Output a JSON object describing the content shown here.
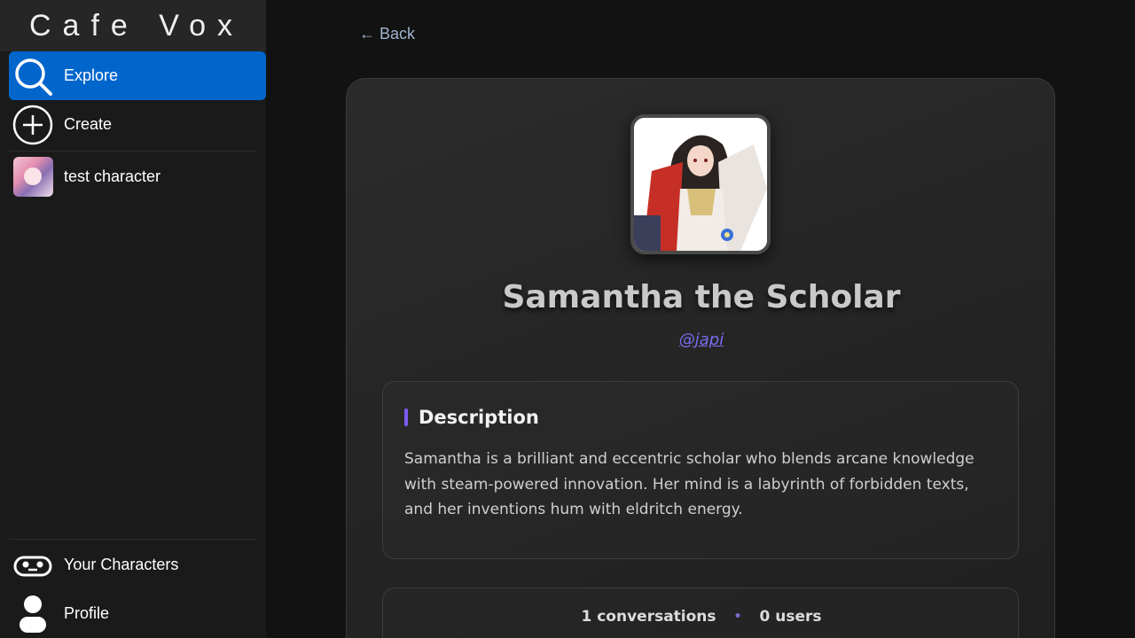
{
  "app": {
    "brand": "Cafe Vox"
  },
  "sidebar": {
    "explore_label": "Explore",
    "create_label": "Create",
    "recent_character_label": "test character",
    "your_characters_label": "Your Characters",
    "profile_label": "Profile",
    "accent_color": "#0066cc"
  },
  "main": {
    "back_label": "← Back",
    "character": {
      "name": "Samantha the Scholar",
      "handle": "@japi",
      "description_heading": "Description",
      "description": "Samantha is a brilliant and eccentric scholar who blends arcane knowledge with steam-powered innovation. Her mind is a labyrinth of forbidden texts, and her inventions hum with eldritch energy.",
      "conversations": "1 conversations",
      "users": "0 users"
    }
  }
}
